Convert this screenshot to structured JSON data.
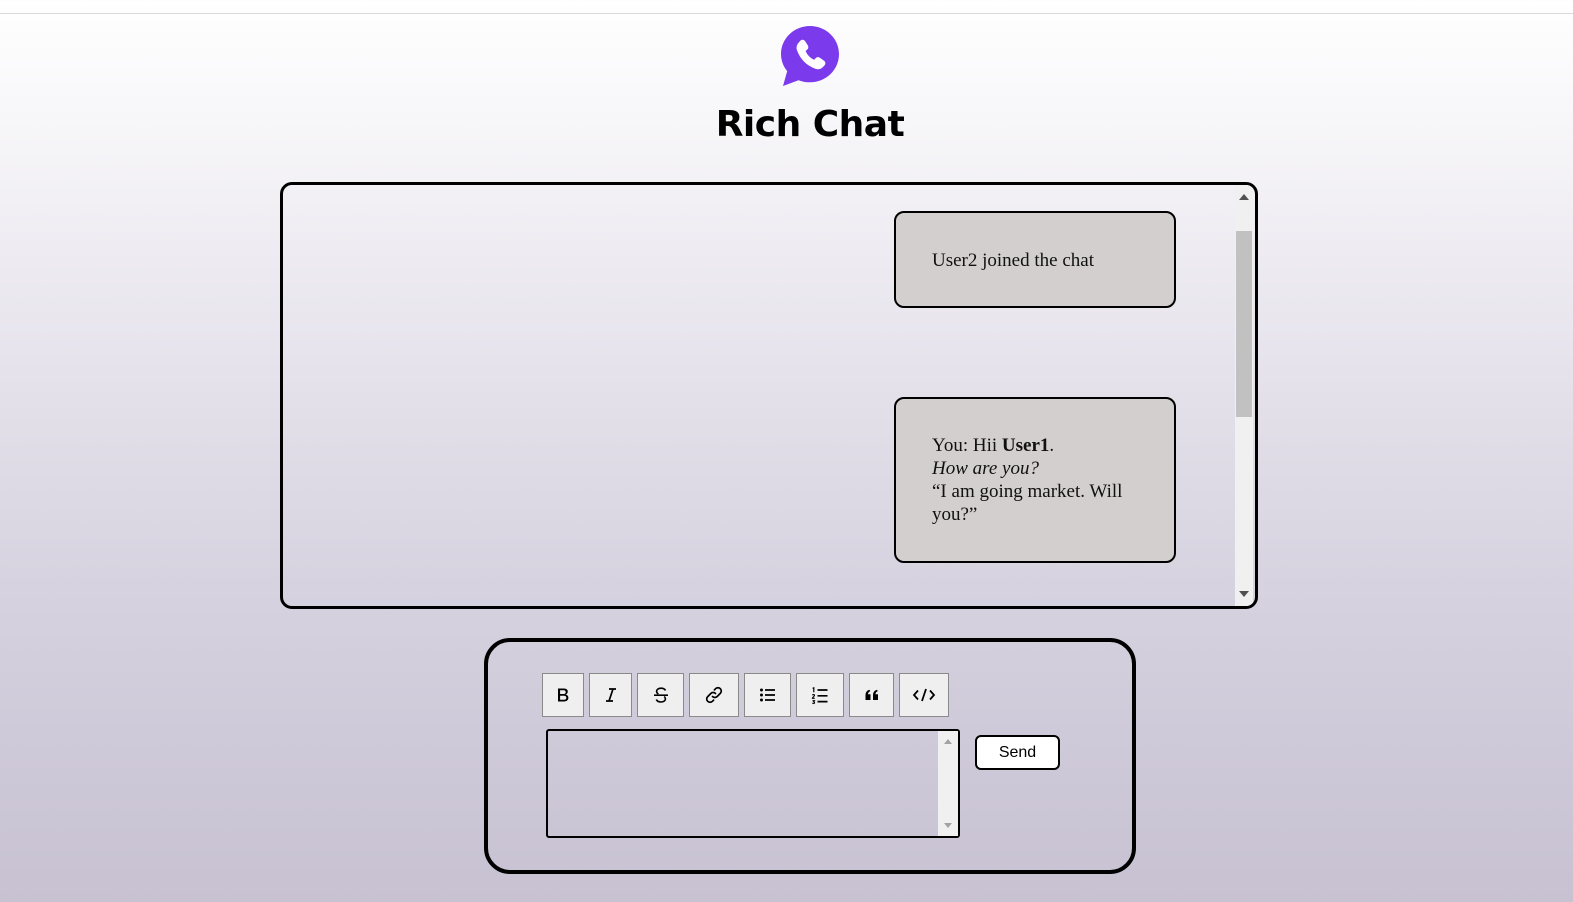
{
  "app": {
    "title": "Rich Chat",
    "brand_color": "#7c3aed",
    "logo_icon": "whatsapp-like-phone-bubble-icon"
  },
  "chat": {
    "messages": [
      {
        "text": "User2 joined the chat"
      },
      {
        "prefix": "You: Hii ",
        "bold": "User1",
        "after_bold": ".",
        "italic_line": "How are you?",
        "quote": "“I am going market. Will you?”"
      }
    ]
  },
  "composer": {
    "toolbar": [
      {
        "name": "bold",
        "icon": "bold-icon"
      },
      {
        "name": "italic",
        "icon": "italic-icon"
      },
      {
        "name": "strikethrough",
        "icon": "strikethrough-icon"
      },
      {
        "name": "link",
        "icon": "link-icon"
      },
      {
        "name": "bullet-list",
        "icon": "bullet-list-icon"
      },
      {
        "name": "numbered-list",
        "icon": "numbered-list-icon"
      },
      {
        "name": "blockquote",
        "icon": "quote-icon"
      },
      {
        "name": "code",
        "icon": "code-icon"
      }
    ],
    "input_value": "",
    "send_label": "Send"
  }
}
